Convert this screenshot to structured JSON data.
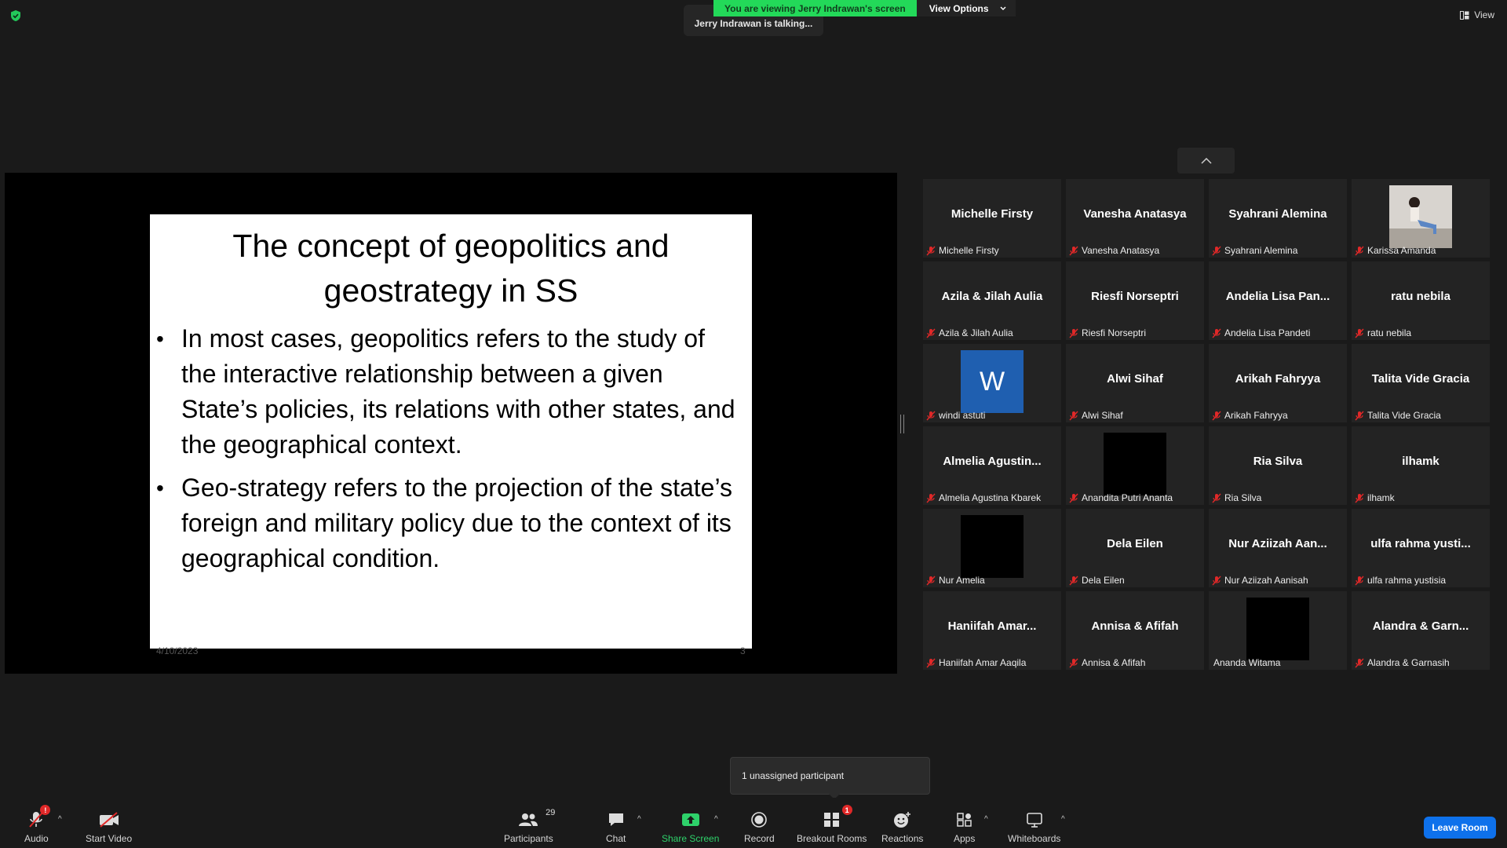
{
  "topbar": {
    "sharing_text": "You are viewing Jerry Indrawan's screen",
    "view_options": "View Options",
    "talking": "Jerry Indrawan is talking...",
    "view": "View"
  },
  "slide": {
    "title": "The concept of geopolitics and geostrategy in SS",
    "bullets": [
      "In most cases, geopolitics refers to the study of the interactive relationship between a given State’s policies, its relations with other states, and the geographical context.",
      "Geo-strategy refers to the projection of the state’s foreign and military policy due to the context of its geographical condition."
    ],
    "date": "4/10/2023",
    "page": "3"
  },
  "participants": [
    {
      "big": "Michelle Firsty",
      "label": "Michelle Firsty"
    },
    {
      "big": "Vanesha Anatasya",
      "label": "Vanesha Anatasya"
    },
    {
      "big": "Syahrani Alemina",
      "label": "Syahrani Alemina"
    },
    {
      "big": "",
      "label": "Karissa Amanda"
    },
    {
      "big": "Azila & Jilah Aulia",
      "label": "Azila & Jilah Aulia"
    },
    {
      "big": "Riesfi Norseptri",
      "label": "Riesfi Norseptri"
    },
    {
      "big": "Andelia Lisa Pan...",
      "label": "Andelia Lisa Pandeti"
    },
    {
      "big": "ratu nebila",
      "label": "ratu nebila"
    },
    {
      "big": "W",
      "label": "windi astuti"
    },
    {
      "big": "Alwi Sihaf",
      "label": "Alwi Sihaf"
    },
    {
      "big": "Arikah Fahryya",
      "label": "Arikah Fahryya"
    },
    {
      "big": "Talita Vide Gracia",
      "label": "Talita Vide Gracia"
    },
    {
      "big": "Almelia Agustin...",
      "label": "Almelia Agustina Kbarek"
    },
    {
      "big": "",
      "label": "Anandita Putri Ananta"
    },
    {
      "big": "Ria Silva",
      "label": "Ria Silva"
    },
    {
      "big": "ilhamk",
      "label": "ilhamk"
    },
    {
      "big": "",
      "label": "Nur Amelia"
    },
    {
      "big": "Dela Eilen",
      "label": "Dela Eilen"
    },
    {
      "big": "Nur Aziizah Aan...",
      "label": "Nur Aziizah Aanisah"
    },
    {
      "big": "ulfa rahma yusti...",
      "label": "ulfa rahma yustisia"
    },
    {
      "big": "Haniifah Amar...",
      "label": "Haniifah Amar Aaqila"
    },
    {
      "big": "Annisa & Afifah",
      "label": "Annisa & Afifah"
    },
    {
      "big": "",
      "label": "Ananda Witama"
    },
    {
      "big": "Alandra & Garn...",
      "label": "Alandra & Garnasih"
    }
  ],
  "tooltip": "1 unassigned participant",
  "toolbar": {
    "audio": "Audio",
    "audio_badge": "!",
    "start_video": "Start Video",
    "participants": "Participants",
    "participants_count": "29",
    "chat": "Chat",
    "share_screen": "Share Screen",
    "record": "Record",
    "breakout_rooms": "Breakout Rooms",
    "breakout_badge": "1",
    "reactions": "Reactions",
    "apps": "Apps",
    "whiteboards": "Whiteboards",
    "leave": "Leave Room"
  },
  "colors": {
    "accent_green": "#23d959",
    "leave_blue": "#0e71eb",
    "mute_red": "#e02828"
  }
}
